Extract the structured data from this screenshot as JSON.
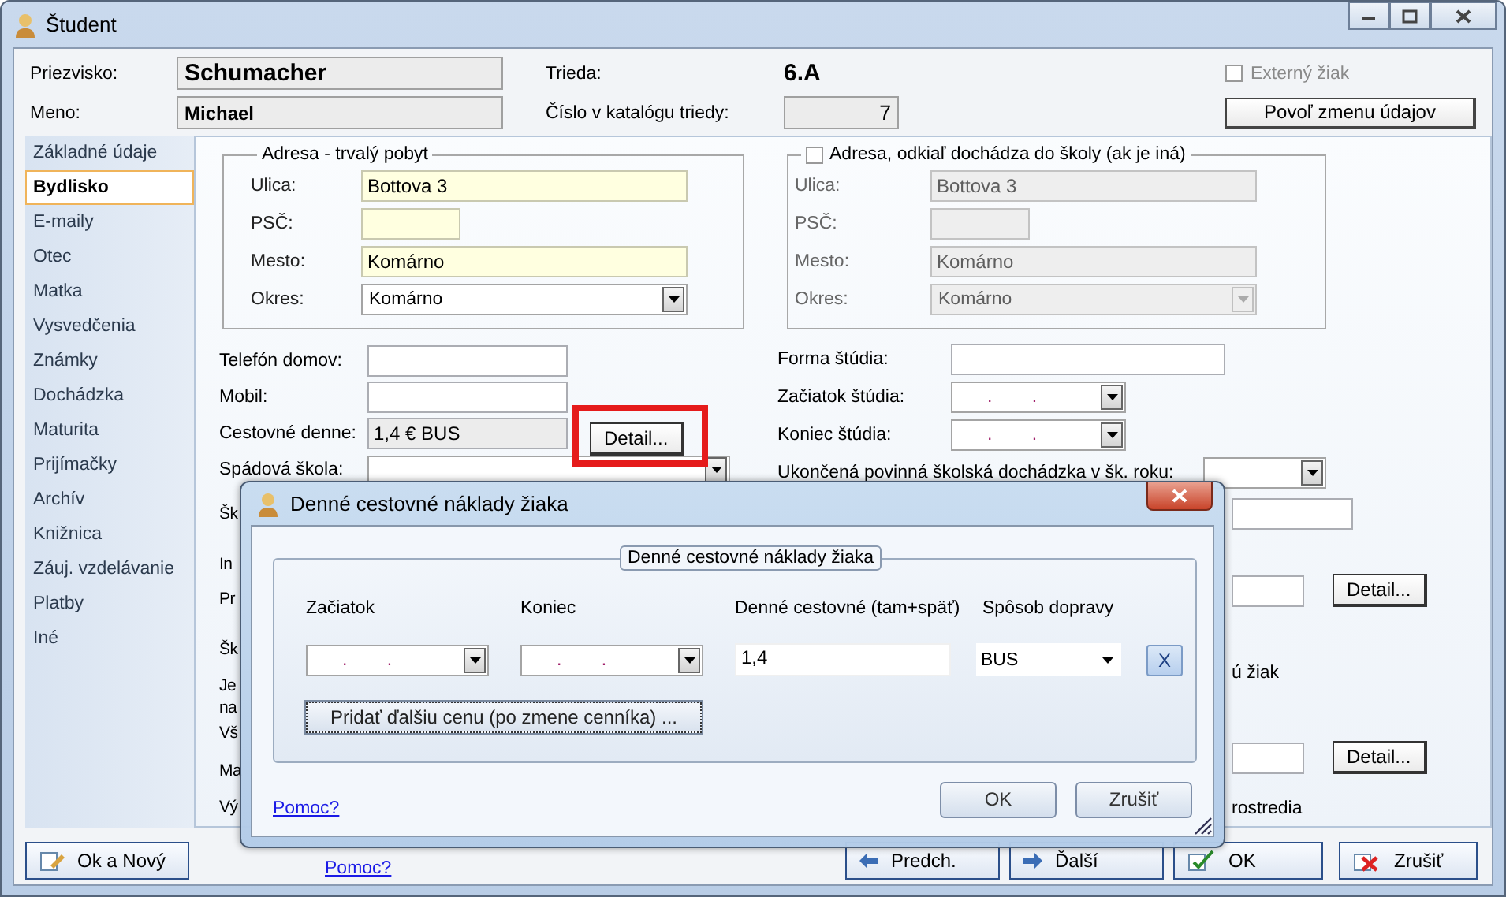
{
  "window": {
    "title": "Študent"
  },
  "header": {
    "surname_label": "Priezvisko:",
    "surname": "Schumacher",
    "name_label": "Meno:",
    "name": "Michael",
    "class_label": "Trieda:",
    "class": "6.A",
    "catalog_label": "Číslo v katalógu triedy:",
    "catalog_number": "7",
    "external": {
      "label": "Externý žiak",
      "checked": false,
      "disabled": true
    },
    "allow_button": "Povoľ zmenu údajov"
  },
  "sidebar": {
    "items": [
      {
        "label": "Základné údaje",
        "selected": false
      },
      {
        "label": "Bydlisko",
        "selected": true
      },
      {
        "label": "E-maily",
        "selected": false
      },
      {
        "label": "Otec",
        "selected": false
      },
      {
        "label": "Matka",
        "selected": false
      },
      {
        "label": "Vysvedčenia",
        "selected": false
      },
      {
        "label": "Známky",
        "selected": false
      },
      {
        "label": "Dochádzka",
        "selected": false
      },
      {
        "label": "Maturita",
        "selected": false
      },
      {
        "label": "Prijímačky",
        "selected": false
      },
      {
        "label": "Archív",
        "selected": false
      },
      {
        "label": "Knižnica",
        "selected": false
      },
      {
        "label": "Záuj. vzdelávanie",
        "selected": false
      },
      {
        "label": "Platby",
        "selected": false
      },
      {
        "label": "Iné",
        "selected": false
      }
    ]
  },
  "permanent_address": {
    "title": "Adresa - trvalý pobyt",
    "fields": [
      {
        "label": "Ulica:",
        "kind": "text",
        "value": "Bottova 3"
      },
      {
        "label": "PSČ:",
        "kind": "short"
      },
      {
        "label": "Mesto:",
        "kind": "text",
        "value": "Komárno"
      },
      {
        "label": "Okres:",
        "kind": "select",
        "value": "Komárno"
      }
    ]
  },
  "school_address": {
    "title": "Adresa, odkiaľ dochádza do školy (ak je iná)",
    "checked": false,
    "fields": [
      {
        "label": "Ulica:",
        "kind": "text",
        "value": "Bottova 3"
      },
      {
        "label": "PSČ:",
        "kind": "short"
      },
      {
        "label": "Mesto:",
        "kind": "text",
        "value": "Komárno"
      },
      {
        "label": "Okres:",
        "kind": "select",
        "value": "Komárno"
      }
    ]
  },
  "left_rows": [
    {
      "label": "Telefón domov:",
      "kind": "text"
    },
    {
      "label": "Mobil:",
      "kind": "text"
    },
    {
      "label": "Cestovné denne:",
      "kind": "readonly",
      "value": "1,4 € BUS",
      "button": "Detail...",
      "highlighted": true
    },
    {
      "label": "Spádová škola:",
      "kind": "select"
    }
  ],
  "left_fragments": [
    "Šk",
    "In",
    "Pr",
    "Šk",
    "Je",
    "na",
    "Vš",
    "Ma",
    "Vý"
  ],
  "right_rows": [
    {
      "label": "Forma štúdia:",
      "kind": "text"
    },
    {
      "label": "Začiatok štúdia:",
      "kind": "date",
      "placeholder": ". ."
    },
    {
      "label": "Koniec štúdia:",
      "kind": "date",
      "placeholder": ". ."
    },
    {
      "label": "Ukončená povinná školská dochádzka v šk. roku:",
      "kind": "select"
    }
  ],
  "right_fragments": [
    {
      "kind": "field"
    },
    {
      "kind": "field_button",
      "button": "Detail..."
    },
    {
      "kind": "text",
      "text": "ú žiak"
    },
    {
      "kind": "field_button",
      "button": "Detail..."
    },
    {
      "kind": "text",
      "text": "rostredia"
    }
  ],
  "bottom_bar": {
    "ok_new": "Ok a Nový",
    "help": "Pomoc?",
    "prev": "Predch.",
    "next": "Ďalší",
    "ok": "OK",
    "cancel": "Zrušiť"
  },
  "dialog": {
    "title": "Denné cestovné náklady žiaka",
    "group_title": "Denné cestovné náklady žiaka",
    "columns": [
      "Začiatok",
      "Koniec",
      "Denné cestovné (tam+späť)",
      "Spôsob dopravy"
    ],
    "row": {
      "start_placeholder": ". .",
      "end_placeholder": ". .",
      "cost": "1,4",
      "transport": "BUS",
      "delete": "X"
    },
    "add_button": "Pridať ďalšiu cenu (po zmene cenníka) ...",
    "help": "Pomoc?",
    "ok": "OK",
    "cancel": "Zrušiť"
  }
}
